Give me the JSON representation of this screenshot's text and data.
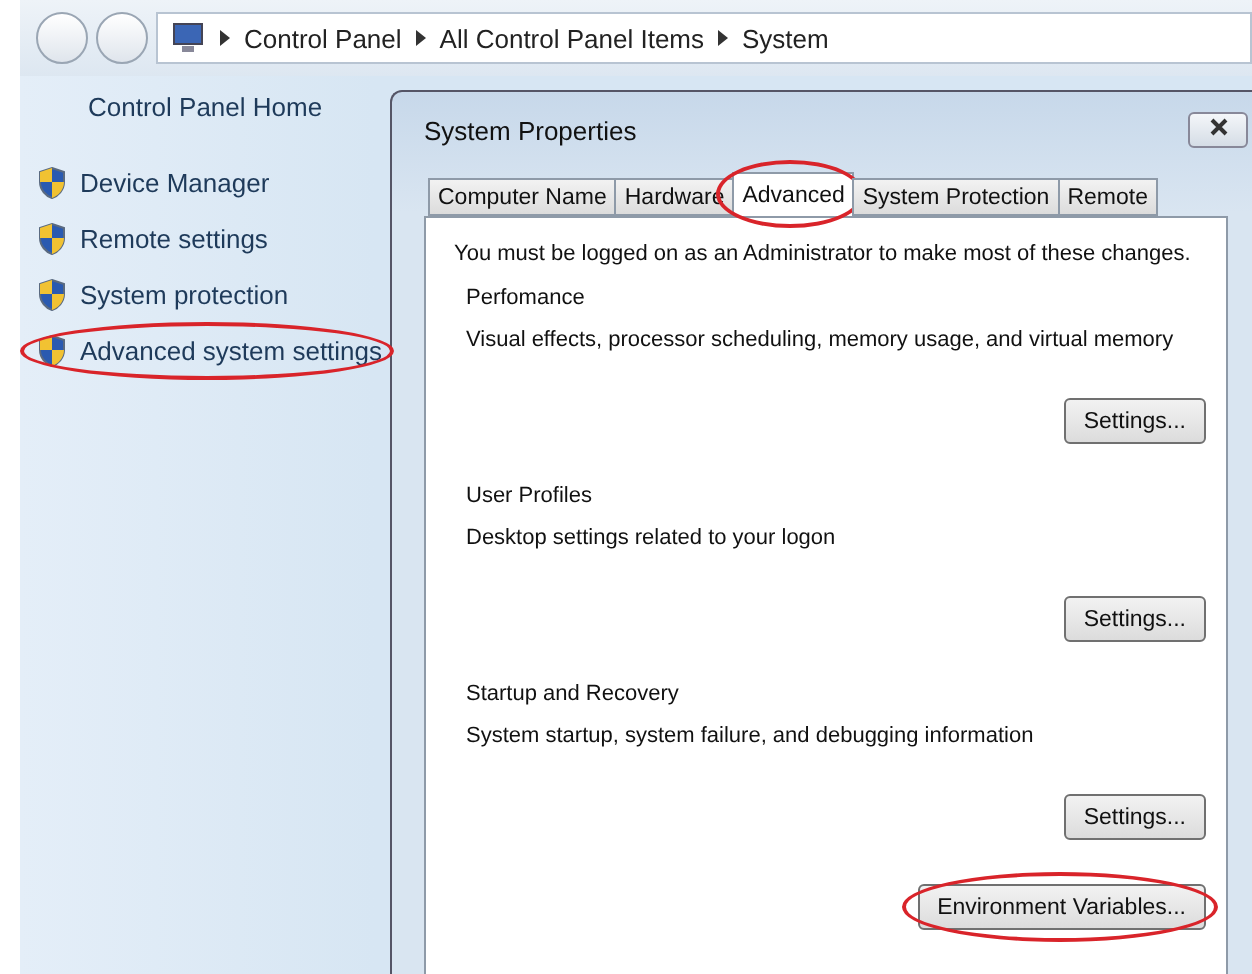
{
  "address_bar": {
    "path": [
      "Control Panel",
      "All Control Panel Items",
      "System"
    ]
  },
  "sidebar": {
    "home": "Control Panel Home",
    "items": [
      {
        "label": "Device Manager",
        "highlighted": false
      },
      {
        "label": "Remote settings",
        "highlighted": false
      },
      {
        "label": "System protection",
        "highlighted": false
      },
      {
        "label": "Advanced system settings",
        "highlighted": true
      }
    ]
  },
  "dialog": {
    "title": "System Properties",
    "tabs": [
      {
        "label": "Computer Name",
        "selected": false,
        "highlighted": false
      },
      {
        "label": "Hardware",
        "selected": false,
        "highlighted": false
      },
      {
        "label": "Advanced",
        "selected": true,
        "highlighted": true
      },
      {
        "label": "System Protection",
        "selected": false,
        "highlighted": false
      },
      {
        "label": "Remote",
        "selected": false,
        "highlighted": false
      }
    ],
    "notice": "You must be logged on as an Administrator to make most of these changes.",
    "groups": [
      {
        "title": "Perfomance",
        "description": "Visual effects, processor scheduling, memory usage, and virtual memory",
        "button": "Settings..."
      },
      {
        "title": "User Profiles",
        "description": "Desktop settings related to your logon",
        "button": "Settings..."
      },
      {
        "title": "Startup and Recovery",
        "description": "System startup, system failure, and debugging information",
        "button": "Settings..."
      }
    ],
    "env_button": {
      "label": "Environment Variables...",
      "highlighted": true
    }
  }
}
